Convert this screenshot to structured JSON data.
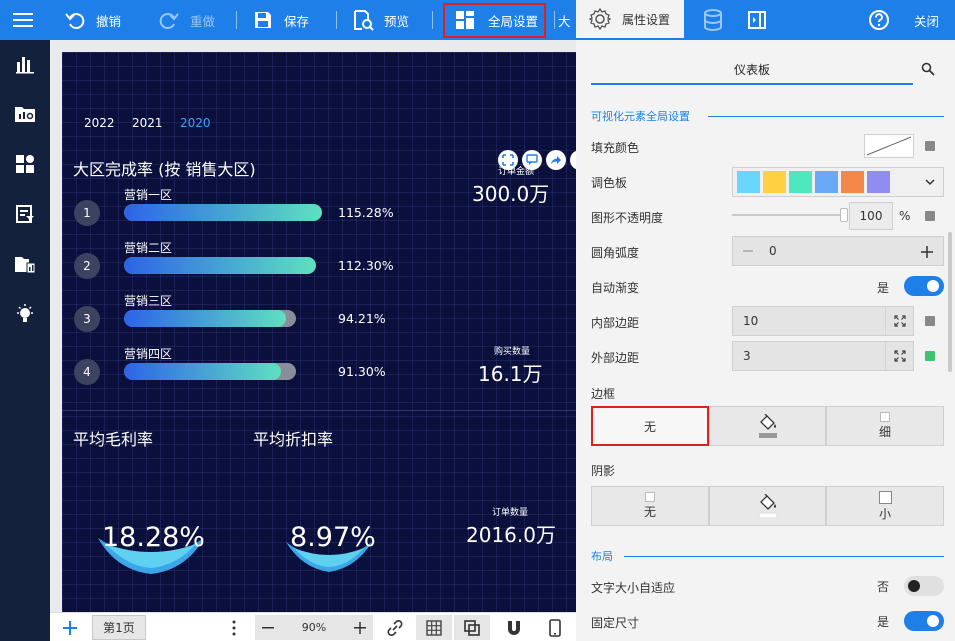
{
  "toolbar": {
    "undo_label": "撤销",
    "redo_label": "重做",
    "save_label": "保存",
    "preview_label": "预览",
    "global_settings_label": "全局设置",
    "truncated_label": "大",
    "properties_label": "属性设置",
    "close_label": "关闭"
  },
  "dashboard": {
    "years": [
      "2022",
      "2021",
      "2020"
    ],
    "active_year": "2020",
    "region_title": "大区完成率 (按 销售大区)",
    "regions": [
      {
        "rank": "1",
        "name": "营销一区",
        "pct": "115.28%",
        "fill": 1.0
      },
      {
        "rank": "2",
        "name": "营销二区",
        "pct": "112.30%",
        "fill": 1.0
      },
      {
        "rank": "3",
        "name": "营销三区",
        "pct": "94.21%",
        "fill": 0.94
      },
      {
        "rank": "4",
        "name": "营销四区",
        "pct": "91.30%",
        "fill": 0.91
      }
    ],
    "stats": [
      {
        "label": "订单金额",
        "value": "300.0万"
      },
      {
        "label": "购买数量",
        "value": "16.1万"
      },
      {
        "label": "订单数量",
        "value": "2016.0万"
      }
    ],
    "gross_margin_title": "平均毛利率",
    "discount_title": "平均折扣率",
    "gross_margin_value": "18.28%",
    "discount_value": "8.97%"
  },
  "bottombar": {
    "page_tab": "第1页",
    "zoom": "90%"
  },
  "panel": {
    "tab_title": "仪表板",
    "section_global": "可视化元素全局设置",
    "fill_color_label": "填充颜色",
    "palette_label": "调色板",
    "palette_colors": [
      "#6ad6ff",
      "#ffcf44",
      "#4de8bd",
      "#6aa9f5",
      "#f5874a",
      "#8f8ef0"
    ],
    "opacity_label": "图形不透明度",
    "opacity_value": "100",
    "opacity_unit": "%",
    "radius_label": "圆角弧度",
    "radius_value": "0",
    "auto_gradient_label": "自动渐变",
    "auto_gradient_value": "是",
    "inner_padding_label": "内部边距",
    "inner_padding_value": "10",
    "outer_padding_label": "外部边距",
    "outer_padding_value": "3",
    "border_label": "边框",
    "border_none": "无",
    "border_thin": "细",
    "shadow_label": "阴影",
    "shadow_none": "无",
    "shadow_small": "小",
    "section_layout": "布局",
    "font_auto_label": "文字大小自适应",
    "font_auto_value": "否",
    "fixed_size_label": "固定尺寸",
    "fixed_size_value": "是",
    "outer_padding_indicator": "#3ec46d"
  }
}
